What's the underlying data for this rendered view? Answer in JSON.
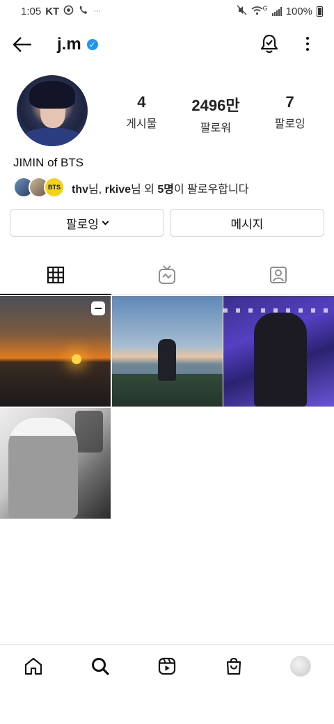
{
  "status_bar": {
    "time": "1:05",
    "carrier": "KT",
    "notification_glyphs": "···",
    "network_type": "G",
    "battery_percent": "100%"
  },
  "header": {
    "username": "j.m",
    "verified_mark": "✓"
  },
  "profile": {
    "stats": [
      {
        "value": "4",
        "label": "게시물"
      },
      {
        "value": "2496만",
        "label": "팔로워"
      },
      {
        "value": "7",
        "label": "팔로잉"
      }
    ],
    "display_name": "JIMIN of BTS",
    "followed_by": {
      "name1": "thv",
      "suffix1": "님, ",
      "name2": "rkive",
      "suffix2": "님 외 ",
      "count": "5명",
      "tail": "이 팔로우합니다",
      "avatar_badge": "BTS"
    }
  },
  "buttons": {
    "following": "팔로잉",
    "message": "메시지"
  },
  "tabs": [
    {
      "icon": "grid-icon",
      "active": true
    },
    {
      "icon": "igtv-icon",
      "active": false
    },
    {
      "icon": "tagged-icon",
      "active": false
    }
  ],
  "posts": [
    {
      "type": "reel",
      "icon": "reel-icon"
    },
    {
      "type": "photo"
    },
    {
      "type": "photo"
    },
    {
      "type": "photo"
    }
  ],
  "bottom_nav": [
    {
      "icon": "home-icon"
    },
    {
      "icon": "search-icon",
      "active": true
    },
    {
      "icon": "reels-icon"
    },
    {
      "icon": "shop-icon"
    },
    {
      "icon": "profile-avatar"
    }
  ],
  "colors": {
    "verified_blue": "#1e96f0",
    "text": "#111111",
    "border": "#d4d4d4"
  }
}
